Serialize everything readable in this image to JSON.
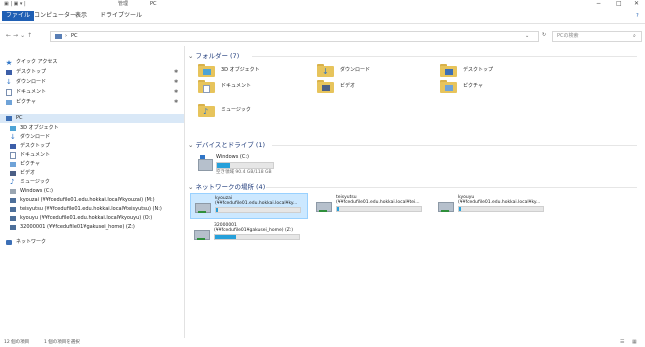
{
  "window": {
    "title": "PC",
    "tool_group": "管理",
    "controls": {
      "minimize": "−",
      "maximize": "□",
      "close": "✕"
    }
  },
  "ribbon": {
    "tabs": [
      "ファイル",
      "コンピューター",
      "表示",
      "ドライブツール"
    ],
    "help": "?"
  },
  "address": {
    "breadcrumb": [
      "PC"
    ],
    "search_placeholder": "PCの検索"
  },
  "sidebar": {
    "quick_access": {
      "label": "クイック アクセス"
    },
    "quick_items": [
      {
        "label": "デスクトップ",
        "icon": "desktop-icon"
      },
      {
        "label": "ダウンロード",
        "icon": "download-icon"
      },
      {
        "label": "ドキュメント",
        "icon": "documents-icon"
      },
      {
        "label": "ピクチャ",
        "icon": "pictures-icon"
      }
    ],
    "pc": {
      "label": "PC"
    },
    "pc_items": [
      {
        "label": "3D オブジェクト",
        "icon": "3d-objects-icon"
      },
      {
        "label": "ダウンロード",
        "icon": "download-icon"
      },
      {
        "label": "デスクトップ",
        "icon": "desktop-icon"
      },
      {
        "label": "ドキュメント",
        "icon": "documents-icon"
      },
      {
        "label": "ピクチャ",
        "icon": "pictures-icon"
      },
      {
        "label": "ビデオ",
        "icon": "videos-icon"
      },
      {
        "label": "ミュージック",
        "icon": "music-icon"
      },
      {
        "label": "Windows (C:)",
        "icon": "drive-icon"
      },
      {
        "label": "kyouzai (¥¥fcedufile01.edu.hokkai.local¥kyouzai) (M:)",
        "icon": "network-drive-icon"
      },
      {
        "label": "teisyutsu (¥¥fcedufile01.edu.hokkai.local¥teisyutsu) (N:)",
        "icon": "network-drive-icon"
      },
      {
        "label": "kyouyu (¥¥fcedufile01.edu.hokkai.local¥kyouyu) (O:)",
        "icon": "network-drive-icon"
      },
      {
        "label": "32000001 (¥¥fcedufile01¥gakusei_home) (Z:)",
        "icon": "network-drive-icon"
      }
    ],
    "network": {
      "label": "ネットワーク"
    }
  },
  "content": {
    "folders_header": "フォルダー (7)",
    "folders": [
      {
        "label": "3D オブジェクト",
        "icon": "3d-objects-icon"
      },
      {
        "label": "ダウンロード",
        "icon": "download-icon"
      },
      {
        "label": "デスクトップ",
        "icon": "desktop-icon"
      },
      {
        "label": "ドキュメント",
        "icon": "documents-icon"
      },
      {
        "label": "ビデオ",
        "icon": "videos-icon"
      },
      {
        "label": "ピクチャ",
        "icon": "pictures-icon"
      },
      {
        "label": "ミュージック",
        "icon": "music-icon"
      }
    ],
    "devices_header": "デバイスとドライブ (1)",
    "drive": {
      "name": "Windows (C:)",
      "free": "空き領域 90.4 GB/118 GB",
      "used_fraction": 0.23
    },
    "network_header": "ネットワークの場所 (4)",
    "network_drives": [
      {
        "name": "kyouzai",
        "path": "(¥¥fcedufile01.edu.hokkai.local¥ky...",
        "used_fraction": 0.02
      },
      {
        "name": "teisyutsu",
        "path": "(¥¥fcedufile01.edu.hokkai.local¥tei...",
        "used_fraction": 0.02
      },
      {
        "name": "kyouyu",
        "path": "(¥¥fcedufile01.edu.hokkai.local¥ky...",
        "used_fraction": 0.02
      },
      {
        "name": "32000001",
        "path": "(¥¥fcedufile01¥gakusei_home) (Z:)",
        "used_fraction": 0.25
      }
    ]
  },
  "status": {
    "items": "12 個の項目",
    "selected": "1 個の項目を選択"
  },
  "colors": {
    "accent": "#1f5fb4",
    "folder": "#e7c45c",
    "bar": "#26a0da",
    "selection": "#cce8ff"
  }
}
